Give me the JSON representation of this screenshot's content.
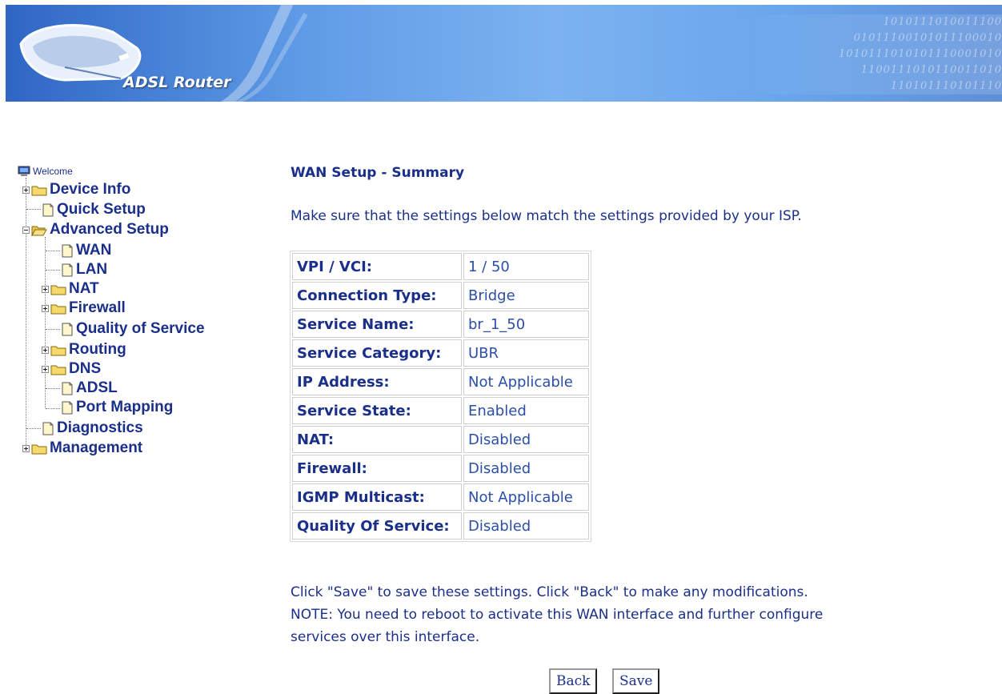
{
  "header": {
    "title": "ADSL Router",
    "binary_lines": [
      "1010111010011100",
      "01011100101011100010",
      "1010111010101110001010",
      "1100111010110011010",
      "110101110101110"
    ]
  },
  "sidebar": {
    "welcome": "Welcome",
    "items": [
      {
        "label": "Device Info",
        "icon": "folder-icon",
        "expander": "plus"
      },
      {
        "label": "Quick Setup",
        "icon": "document-icon"
      },
      {
        "label": "Advanced Setup",
        "icon": "folder-open-icon",
        "expander": "minus"
      },
      {
        "label": "WAN",
        "icon": "document-icon"
      },
      {
        "label": "LAN",
        "icon": "document-icon"
      },
      {
        "label": "NAT",
        "icon": "folder-icon",
        "expander": "plus"
      },
      {
        "label": "Firewall",
        "icon": "folder-icon",
        "expander": "plus"
      },
      {
        "label": "Quality of Service",
        "icon": "document-icon"
      },
      {
        "label": "Routing",
        "icon": "folder-icon",
        "expander": "plus"
      },
      {
        "label": "DNS",
        "icon": "folder-icon",
        "expander": "plus"
      },
      {
        "label": "ADSL",
        "icon": "document-icon"
      },
      {
        "label": "Port Mapping",
        "icon": "document-icon"
      },
      {
        "label": "Diagnostics",
        "icon": "document-icon"
      },
      {
        "label": "Management",
        "icon": "folder-icon",
        "expander": "plus"
      }
    ]
  },
  "main": {
    "title": "WAN Setup - Summary",
    "intro": "Make sure that the settings below match the settings provided by your ISP.",
    "rows": [
      {
        "key": "VPI / VCI:",
        "value": "1 / 50"
      },
      {
        "key": "Connection Type:",
        "value": "Bridge"
      },
      {
        "key": "Service Name:",
        "value": "br_1_50"
      },
      {
        "key": "Service Category:",
        "value": "UBR"
      },
      {
        "key": "IP Address:",
        "value": "Not Applicable"
      },
      {
        "key": "Service State:",
        "value": "Enabled"
      },
      {
        "key": "NAT:",
        "value": "Disabled"
      },
      {
        "key": "Firewall:",
        "value": "Disabled"
      },
      {
        "key": "IGMP Multicast:",
        "value": "Not Applicable"
      },
      {
        "key": "Quality Of Service:",
        "value": "Disabled"
      }
    ],
    "note_line1": "Click \"Save\" to save these settings. Click \"Back\" to make any modifications.",
    "note_line2": "NOTE: You need to reboot to activate this WAN interface and further configure",
    "note_line3": "services over this interface.",
    "back_label": "Back",
    "save_label": "Save"
  },
  "colors": {
    "text": "#1a2f8a",
    "value_text": "#2a4fa8",
    "banner_dark": "#2f66c4",
    "banner_light": "#7cb2f0"
  }
}
